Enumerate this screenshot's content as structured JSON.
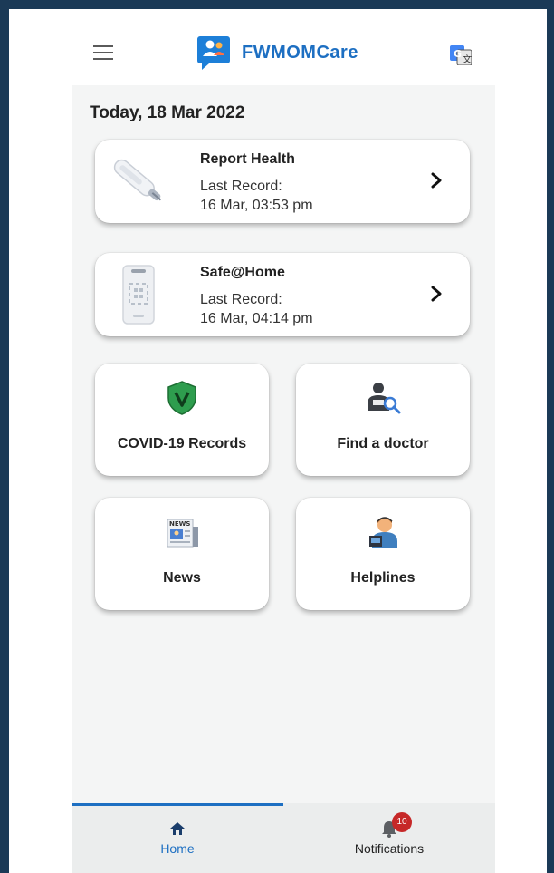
{
  "header": {
    "app_name": "FWMOMCare",
    "brand_color": "#1d6fc2",
    "icons": {
      "menu": "hamburger-menu-icon",
      "translate": "google-translate-icon"
    }
  },
  "date_label": "Today, 18 Mar 2022",
  "records": [
    {
      "title": "Report Health",
      "last_label": "Last Record:",
      "last_value": "16 Mar, 03:53 pm",
      "icon": "thermometer-icon"
    },
    {
      "title": "Safe@Home",
      "last_label": "Last Record:",
      "last_value": "16 Mar, 04:14 pm",
      "icon": "phone-qr-icon"
    }
  ],
  "tiles": [
    {
      "label": "COVID-19 Records",
      "icon": "shield-v-icon",
      "color": "#2e9d4e"
    },
    {
      "label": "Find a doctor",
      "icon": "doctor-search-icon"
    },
    {
      "label": "News",
      "icon": "newspaper-icon",
      "icon_text": "NEWS"
    },
    {
      "label": "Helplines",
      "icon": "helpline-agent-icon"
    }
  ],
  "bottom_nav": {
    "items": [
      {
        "label": "Home",
        "icon": "home-icon",
        "active": true,
        "color": "#1d6fc2"
      },
      {
        "label": "Notifications",
        "icon": "bell-icon",
        "badge": "10",
        "badge_color": "#c62828"
      }
    ]
  }
}
